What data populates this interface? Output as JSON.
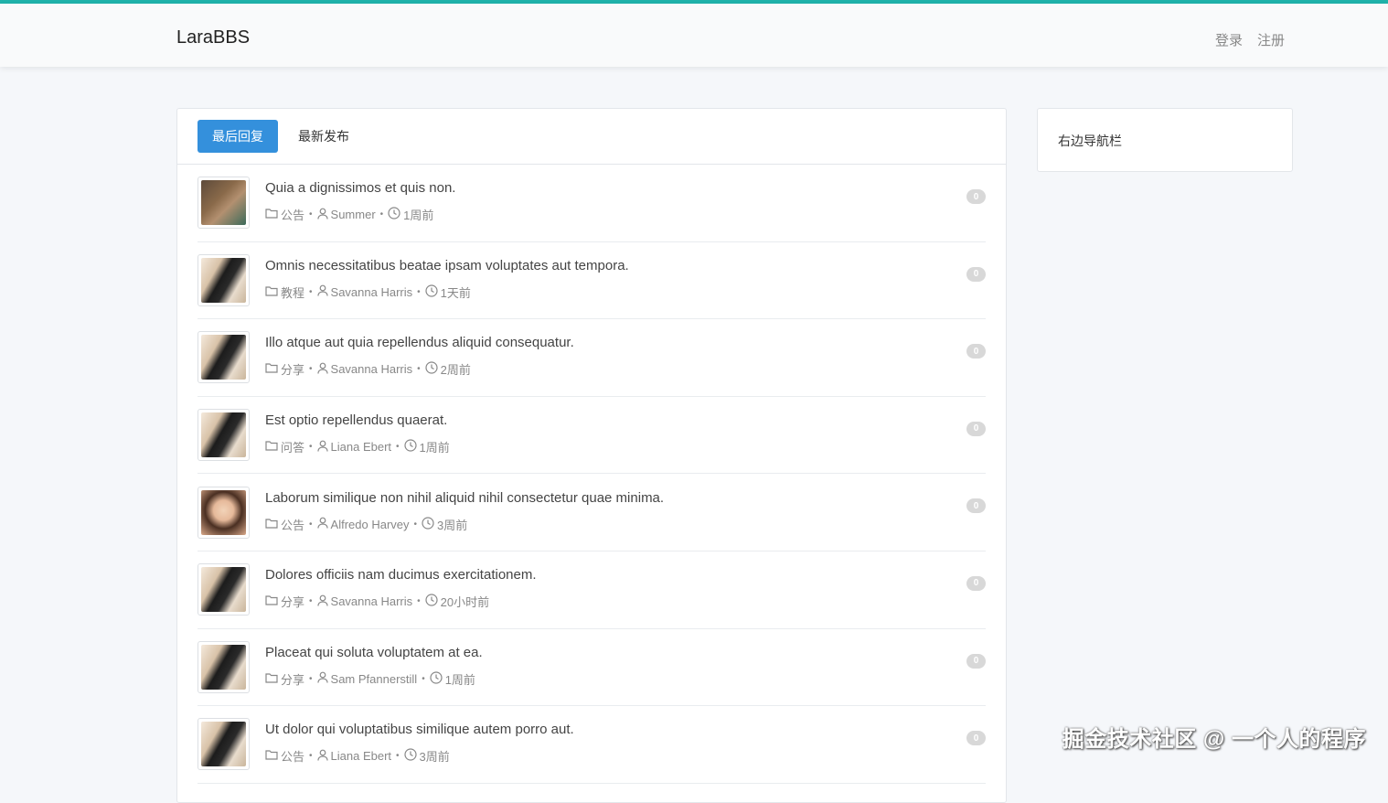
{
  "header": {
    "brand": "LaraBBS",
    "login": "登录",
    "register": "注册"
  },
  "tabs": [
    {
      "label": "最后回复",
      "active": true
    },
    {
      "label": "最新发布",
      "active": false
    }
  ],
  "topics": [
    {
      "title": "Quia a dignissimos et quis non.",
      "category": "公告",
      "author": "Summer",
      "time": "1周前",
      "replies": "0",
      "avatar": "av-a"
    },
    {
      "title": "Omnis necessitatibus beatae ipsam voluptates aut tempora.",
      "category": "教程",
      "author": "Savanna Harris",
      "time": "1天前",
      "replies": "0",
      "avatar": "av-b"
    },
    {
      "title": "Illo atque aut quia repellendus aliquid consequatur.",
      "category": "分享",
      "author": "Savanna Harris",
      "time": "2周前",
      "replies": "0",
      "avatar": "av-b"
    },
    {
      "title": "Est optio repellendus quaerat.",
      "category": "问答",
      "author": "Liana Ebert",
      "time": "1周前",
      "replies": "0",
      "avatar": "av-b"
    },
    {
      "title": "Laborum similique non nihil aliquid nihil consectetur quae minima.",
      "category": "公告",
      "author": "Alfredo Harvey",
      "time": "3周前",
      "replies": "0",
      "avatar": "av-c"
    },
    {
      "title": "Dolores officiis nam ducimus exercitationem.",
      "category": "分享",
      "author": "Savanna Harris",
      "time": "20小时前",
      "replies": "0",
      "avatar": "av-b"
    },
    {
      "title": "Placeat qui soluta voluptatem at ea.",
      "category": "分享",
      "author": "Sam Pfannerstill",
      "time": "1周前",
      "replies": "0",
      "avatar": "av-b"
    },
    {
      "title": "Ut dolor qui voluptatibus similique autem porro aut.",
      "category": "公告",
      "author": "Liana Ebert",
      "time": "3周前",
      "replies": "0",
      "avatar": "av-b"
    }
  ],
  "sidebar": {
    "title": "右边导航栏"
  },
  "watermark": "掘金技术社区 @ 一个人的程序",
  "colors": {
    "accent": "#20b2aa",
    "active_tab": "#3490dc"
  }
}
